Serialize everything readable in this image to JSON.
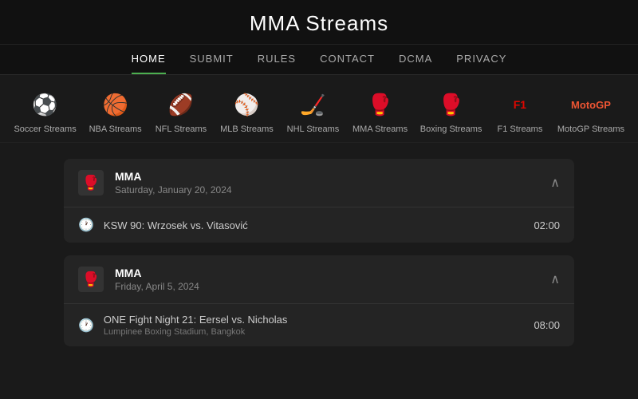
{
  "header": {
    "title": "MMA Streams"
  },
  "nav": {
    "items": [
      {
        "label": "HOME",
        "active": true
      },
      {
        "label": "SUBMIT",
        "active": false
      },
      {
        "label": "RULES",
        "active": false
      },
      {
        "label": "CONTACT",
        "active": false
      },
      {
        "label": "DCMA",
        "active": false
      },
      {
        "label": "PRIVACY",
        "active": false
      }
    ]
  },
  "sports": [
    {
      "id": "soccer",
      "icon": "⚽",
      "label": "Soccer Streams"
    },
    {
      "id": "nba",
      "icon": "🏀",
      "label": "NBA Streams"
    },
    {
      "id": "nfl",
      "icon": "🏈",
      "label": "NFL Streams"
    },
    {
      "id": "mlb",
      "icon": "⚾",
      "label": "MLB Streams"
    },
    {
      "id": "nhl",
      "icon": "🏒",
      "label": "NHL Streams"
    },
    {
      "id": "mma",
      "icon": "🥊",
      "label": "MMA Streams"
    },
    {
      "id": "boxing",
      "icon": "🥊",
      "label": "Boxing Streams"
    },
    {
      "id": "f1",
      "icon": "🏎",
      "label": "F1 Streams"
    },
    {
      "id": "motogp",
      "icon": "🏍",
      "label": "MotoGP Streams"
    }
  ],
  "events": [
    {
      "title": "MMA",
      "date": "Saturday, January 20, 2024",
      "matches": [
        {
          "name": "KSW 90: Wrzosek vs. Vitasović",
          "venue": "",
          "time": "02:00"
        }
      ]
    },
    {
      "title": "MMA",
      "date": "Friday, April 5, 2024",
      "matches": [
        {
          "name": "ONE Fight Night 21: Eersel vs. Nicholas",
          "venue": "Lumpinee Boxing Stadium, Bangkok",
          "time": "08:00"
        }
      ]
    }
  ]
}
